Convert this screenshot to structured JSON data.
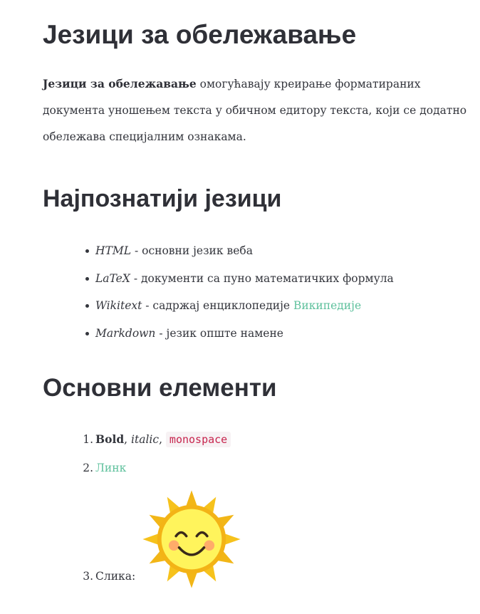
{
  "title": "Језици за обележавање",
  "intro": {
    "bold": "Језици за обележавање",
    "rest": " омогућавају креирање форматираних документа уношењем текста у обичном едитору текста, који се додатно обележава специјалним ознакама."
  },
  "section_languages": {
    "heading": "Најпознатији језици",
    "items": [
      {
        "name": "HTML",
        "desc": " - основни језик веба",
        "link": ""
      },
      {
        "name": "LaTeX",
        "desc": " - документи са пуно математичких формула",
        "link": ""
      },
      {
        "name": "Wikitext",
        "desc": " - садржај енциклопедије ",
        "link": "Википедије"
      },
      {
        "name": "Markdown",
        "desc": " - језик опште намене",
        "link": ""
      }
    ]
  },
  "section_elements": {
    "heading": "Основни елементи",
    "items": {
      "n1": "1.",
      "bold": "Bold",
      "sep1": ", ",
      "italic": "italic",
      "sep2": ", ",
      "mono": "monospace",
      "n2": "2.",
      "link": "Линк",
      "n3": "3.",
      "image_label": "Слика:"
    }
  },
  "colors": {
    "text": "#34363d",
    "heading": "#2f3037",
    "link": "#5fc19d",
    "code_text": "#c7254e",
    "code_bg": "#f7f2f4",
    "sun_rays": "#f2b617",
    "sun_face": "#fff45c"
  },
  "icons": {
    "picture": "smiling-sun-icon"
  }
}
